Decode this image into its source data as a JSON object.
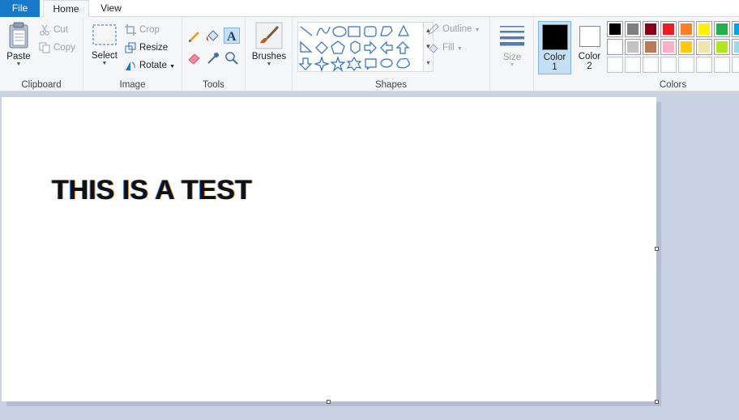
{
  "tabs": {
    "file": "File",
    "home": "Home",
    "view": "View"
  },
  "clipboard": {
    "paste": "Paste",
    "cut": "Cut",
    "copy": "Copy",
    "label": "Clipboard"
  },
  "image": {
    "select": "Select",
    "crop": "Crop",
    "resize": "Resize",
    "rotate": "Rotate",
    "label": "Image"
  },
  "tools": {
    "label": "Tools"
  },
  "brushes": {
    "label": "Brushes"
  },
  "shapes": {
    "outline": "Outline",
    "fill": "Fill",
    "label": "Shapes"
  },
  "size": {
    "label": "Size"
  },
  "colors": {
    "color1_line1": "Color",
    "color1_line2": "1",
    "color2_line1": "Color",
    "color2_line2": "2",
    "label": "Colors",
    "color1_value": "#000000",
    "color2_value": "#ffffff",
    "palette_row1": [
      "#000000",
      "#7f7f7f",
      "#880015",
      "#ed1c24",
      "#ff7f27",
      "#fff200",
      "#22b14c",
      "#00a2e8"
    ],
    "palette_row2": [
      "#ffffff",
      "#c3c3c3",
      "#b97a57",
      "#ffaec9",
      "#ffc90e",
      "#efe4b0",
      "#b5e61d",
      "#99d9ea"
    ],
    "palette_row3": [
      "#ffffff",
      "#ffffff",
      "#ffffff",
      "#ffffff",
      "#ffffff",
      "#ffffff",
      "#ffffff",
      "#ffffff"
    ]
  },
  "canvas": {
    "text": "THIS IS A TEST"
  }
}
